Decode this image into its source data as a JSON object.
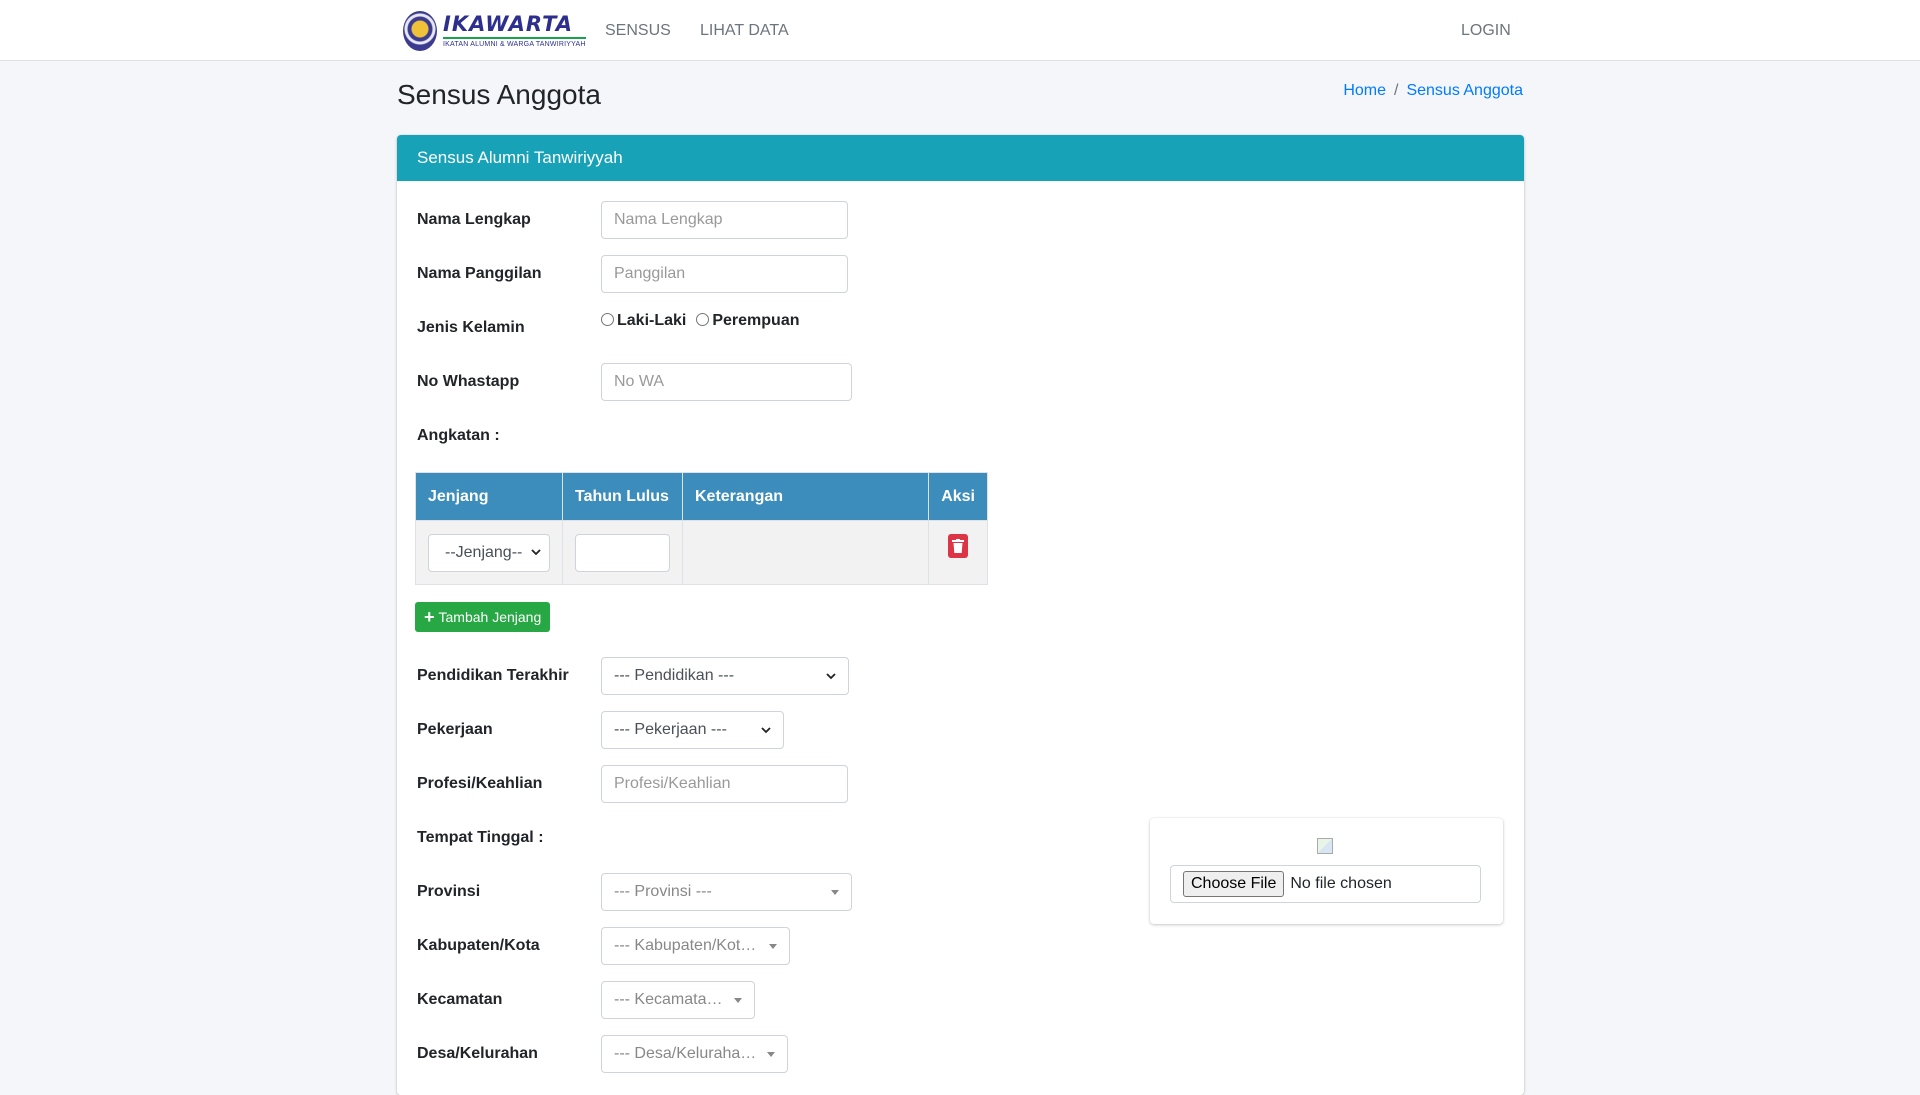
{
  "navbar": {
    "brand_name": "IKAWARTA",
    "brand_sub": "IKATAN ALUMNI & WARGA TANWIRIYYAH",
    "links": [
      "SENSUS",
      "LIHAT DATA"
    ],
    "login": "LOGIN"
  },
  "header": {
    "title": "Sensus Anggota",
    "breadcrumb": [
      "Home",
      "Sensus Anggota"
    ],
    "separator": "/"
  },
  "card": {
    "title": "Sensus Alumni Tanwiriyyah"
  },
  "form": {
    "nama_lengkap": {
      "label": "Nama Lengkap",
      "placeholder": "Nama Lengkap"
    },
    "nama_panggilan": {
      "label": "Nama Panggilan",
      "placeholder": "Panggilan"
    },
    "jenis_kelamin": {
      "label": "Jenis Kelamin",
      "options": [
        "Laki-Laki",
        "Perempuan"
      ]
    },
    "no_whatsapp": {
      "label": "No Whastapp",
      "placeholder": "No WA"
    },
    "angkatan": {
      "label": "Angkatan :"
    },
    "table": {
      "headers": [
        "Jenjang",
        "Tahun Lulus",
        "Keterangan",
        "Aksi"
      ],
      "row": {
        "jenjang_select": "--Jenjang--"
      }
    },
    "add_button": "Tambah Jenjang",
    "pendidikan": {
      "label": "Pendidikan Terakhir",
      "value": "--- Pendidikan ---"
    },
    "pekerjaan": {
      "label": "Pekerjaan",
      "value": "--- Pekerjaan ---"
    },
    "profesi": {
      "label": "Profesi/Keahlian",
      "placeholder": "Profesi/Keahlian"
    },
    "tempat_tinggal": {
      "label": "Tempat Tinggal :"
    },
    "provinsi": {
      "label": "Provinsi",
      "value": "--- Provinsi ---"
    },
    "kabupaten": {
      "label": "Kabupaten/Kota",
      "value": "--- Kabupaten/Kota ---"
    },
    "kecamatan": {
      "label": "Kecamatan",
      "value": "--- Kecamatan ---"
    },
    "desa": {
      "label": "Desa/Kelurahan",
      "value": "--- Desa/Kelurahan ---"
    }
  },
  "upload": {
    "button": "Choose File",
    "status": "No file chosen"
  },
  "colors": {
    "card_header": "#17a2b8",
    "table_header": "#3c8dbc",
    "add_button": "#28a745",
    "delete_button": "#dc3545",
    "link": "#007bff"
  }
}
